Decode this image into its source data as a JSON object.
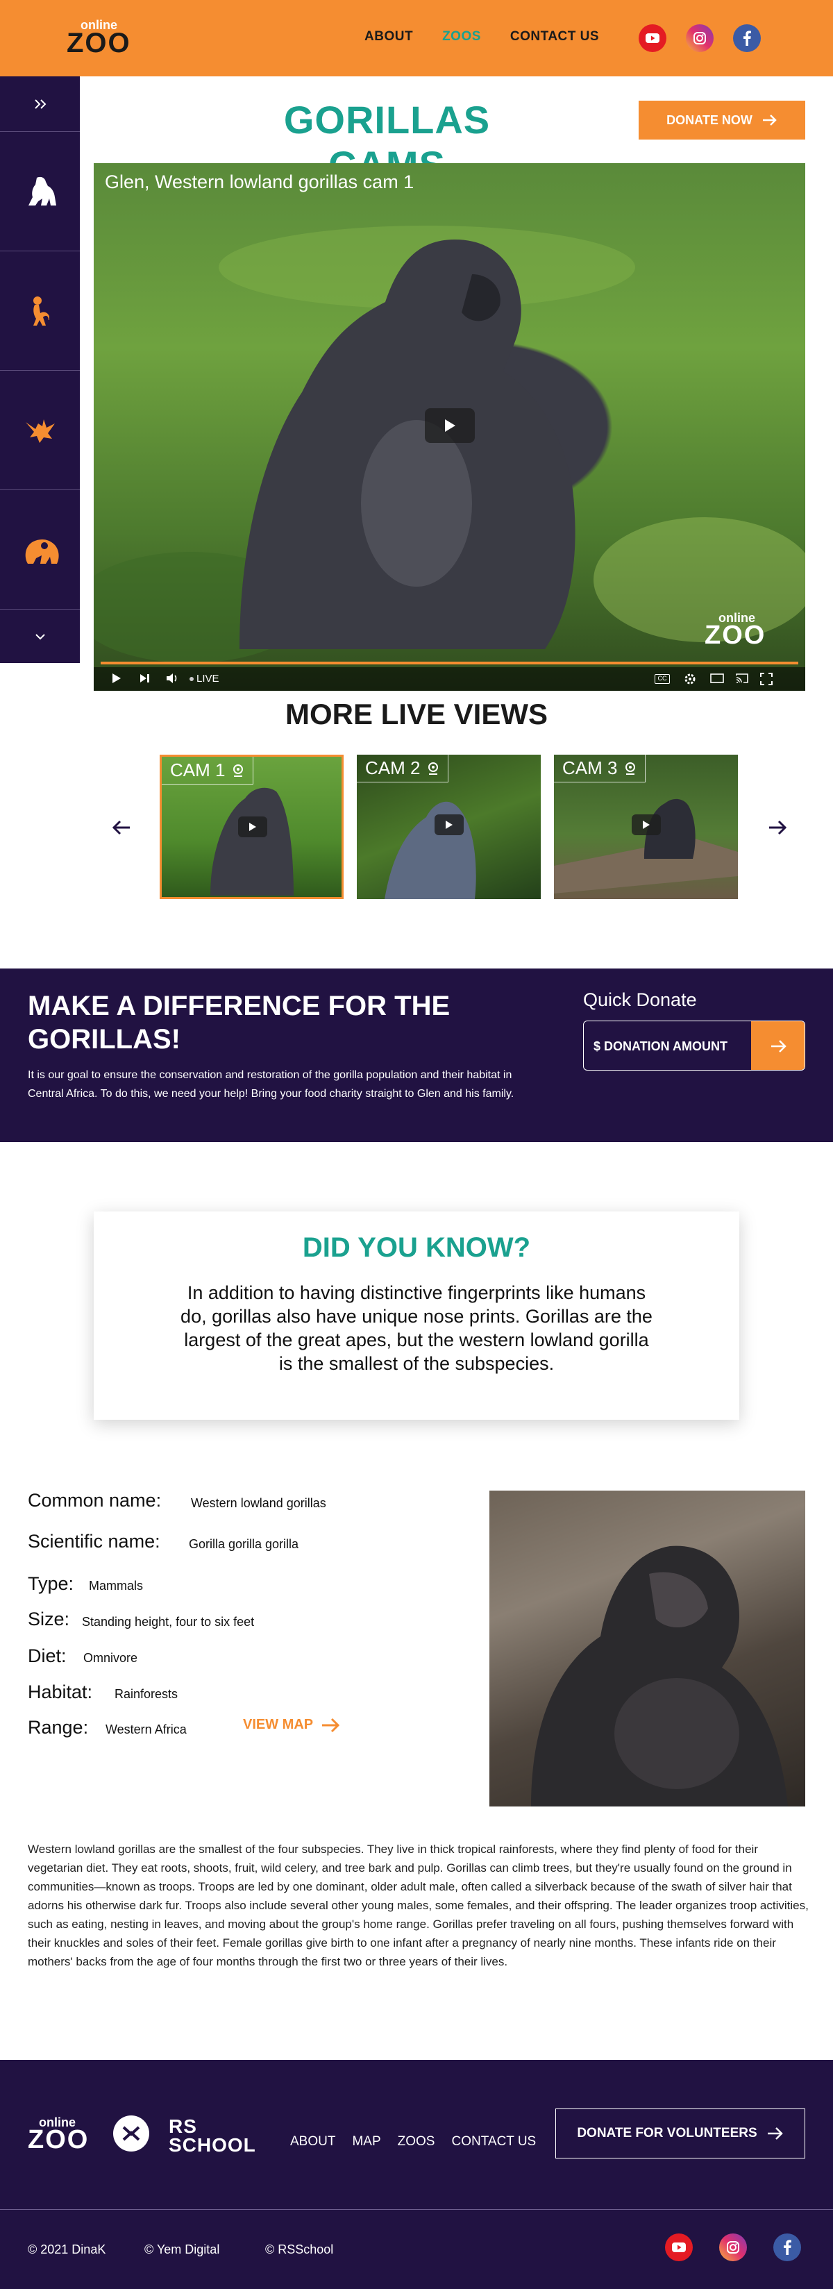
{
  "header": {
    "logo_top": "online",
    "logo_big": "ZOO",
    "nav": [
      "ABOUT",
      "ZOOS",
      "CONTACT US"
    ],
    "active_nav": "ZOOS",
    "social": [
      "youtube-icon",
      "instagram-icon",
      "facebook-icon"
    ],
    "colors": {
      "accent": "#f58d31",
      "teal": "#1aa18f",
      "purple": "#211242"
    }
  },
  "sidebar": {
    "items": [
      "expand-icon",
      "gorilla-icon",
      "monkey-icon",
      "eagle-icon",
      "panda-icon",
      "chevron-down-icon"
    ]
  },
  "cams": {
    "title": "GORILLAS CAMS",
    "donate_label": "DONATE NOW",
    "video_caption": "Glen, Western lowland gorillas cam 1",
    "live_label": "LIVE",
    "more_title": "MORE LIVE VIEWS",
    "thumbs": [
      {
        "label": "CAM 1",
        "active": true
      },
      {
        "label": "CAM 2",
        "active": false
      },
      {
        "label": "CAM 3",
        "active": false
      }
    ]
  },
  "difference": {
    "title": "MAKE A DIFFERENCE FOR THE GORILLAS!",
    "text": " It is our goal to ensure the conservation and restoration of the gorilla population and their habitat in Central Africa. To do this, we need your help! Bring your food charity straight to Glen and his family.",
    "quick_label": "Quick Donate",
    "amount_placeholder": "$ DONATION AMOUNT"
  },
  "did_you_know": {
    "title": "DID YOU KNOW?",
    "text": "In addition to having distinctive fingerprints like humans do, gorillas also have unique nose prints.  Gorillas are the largest of the great apes, but the western lowland gorilla is the smallest of the subspecies."
  },
  "facts": [
    {
      "label": "Common name:",
      "value": "Western lowland gorillas"
    },
    {
      "label": "Scientific name:",
      "value": "Gorilla gorilla gorilla"
    },
    {
      "label": "Type:",
      "value": "Mammals"
    },
    {
      "label": "Size:",
      "value": "Standing height, four to six feet"
    },
    {
      "label": "Diet:",
      "value": "Omnivore"
    },
    {
      "label": "Habitat:",
      "value": "Rainforests"
    },
    {
      "label": "Range:",
      "value": "Western Africa"
    }
  ],
  "view_map_label": "VIEW MAP",
  "long_text": "Western lowland gorillas are the smallest of the four subspecies. They live in thick tropical rainforests, where they find plenty of food for their vegetarian diet. They eat roots, shoots, fruit, wild celery, and tree bark and pulp. Gorillas can climb trees, but they're usually found on the ground in communities—known as troops. Troops are led by one dominant, older adult male, often called a silverback because of the swath of silver hair that adorns his otherwise dark fur. Troops also include several other young males, some females, and their offspring. The leader organizes troop activities, such as eating, nesting in leaves, and moving about the group's home range. Gorillas prefer traveling on all fours, pushing themselves forward with their knuckles and soles of their feet. Female gorillas give birth to one infant after a pregnancy of nearly nine months. These infants ride on their mothers' backs from the age of four months through the first two or three years of their lives.",
  "footer": {
    "nav": [
      "ABOUT",
      "MAP",
      "ZOOS",
      "CONTACT US"
    ],
    "donate_label": "DONATE FOR VOLUNTEERS",
    "copyrights": [
      "© 2021 DinaK",
      "© Yem Digital",
      "© RSSchool"
    ],
    "rs_school_logo": "RS SCHOOL"
  }
}
